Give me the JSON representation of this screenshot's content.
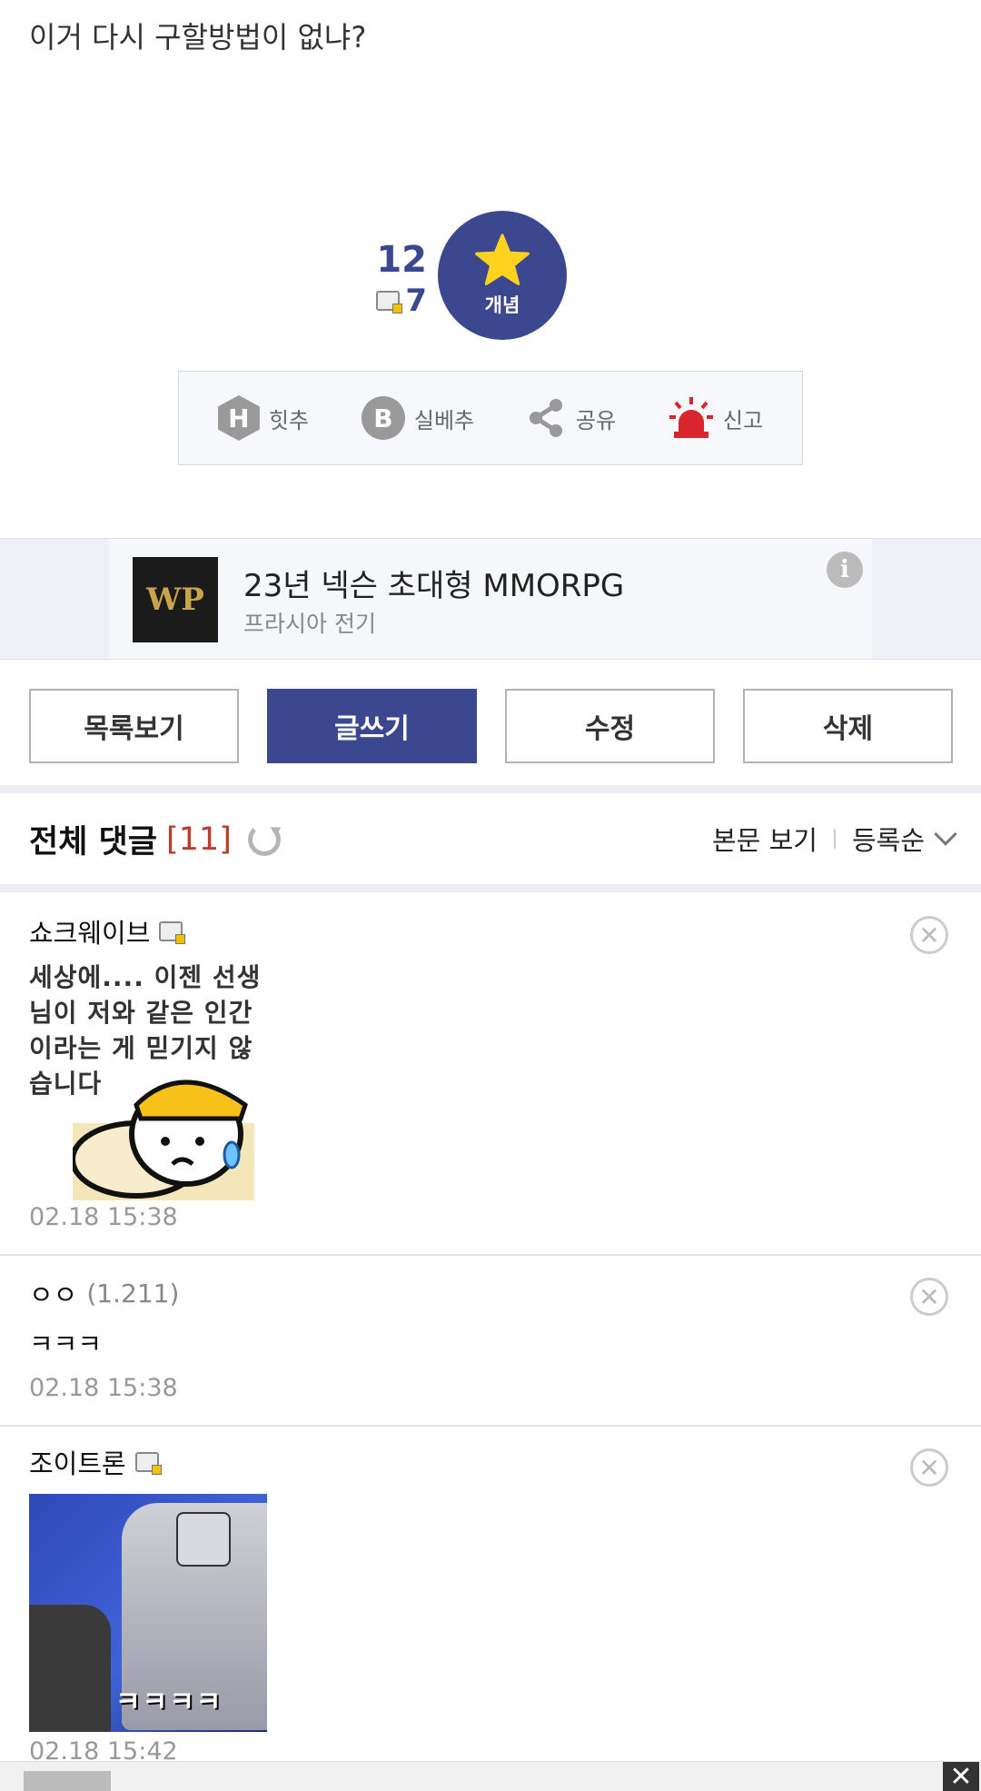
{
  "post": {
    "body_text": "이거 다시 구할방법이 없냐?"
  },
  "recommend": {
    "count": "12",
    "fix_count": "7",
    "button_label": "개념",
    "accent_color": "#3b4890",
    "star_color": "#ffd21e"
  },
  "actions": [
    {
      "icon": "hit-icon",
      "glyph": "H",
      "label": "힛추"
    },
    {
      "icon": "best-icon",
      "glyph": "B",
      "label": "실베추"
    },
    {
      "icon": "share-icon",
      "label": "공유"
    },
    {
      "icon": "siren-icon",
      "label": "신고"
    }
  ],
  "ad": {
    "logo_text": "WP",
    "title": "23년 넥슨 초대형 MMORPG",
    "subtitle": "프라시아 전기",
    "info_glyph": "i"
  },
  "buttons": {
    "list": "목록보기",
    "write": "글쓰기",
    "edit": "수정",
    "delete": "삭제"
  },
  "comments_header": {
    "title": "전체 댓글",
    "count": "[11]",
    "view_body": "본문 보기",
    "sort": "등록순"
  },
  "comments": [
    {
      "author": "쇼크웨이브",
      "dccon_text": "세상에.... 이젠 선생님이 저와 같은 인간이라는 게 믿기지 않습니다",
      "time": "02.18 15:38"
    },
    {
      "author": "ㅇㅇ",
      "ip": "(1.211)",
      "text": "ㅋㅋㅋ",
      "time": "02.18 15:38"
    },
    {
      "author": "조이트론",
      "dccon_text": "ㅋㅋㅋㅋ",
      "time": "02.18 15:42"
    }
  ],
  "delete_glyph": "✕",
  "close_glyph": "✕"
}
